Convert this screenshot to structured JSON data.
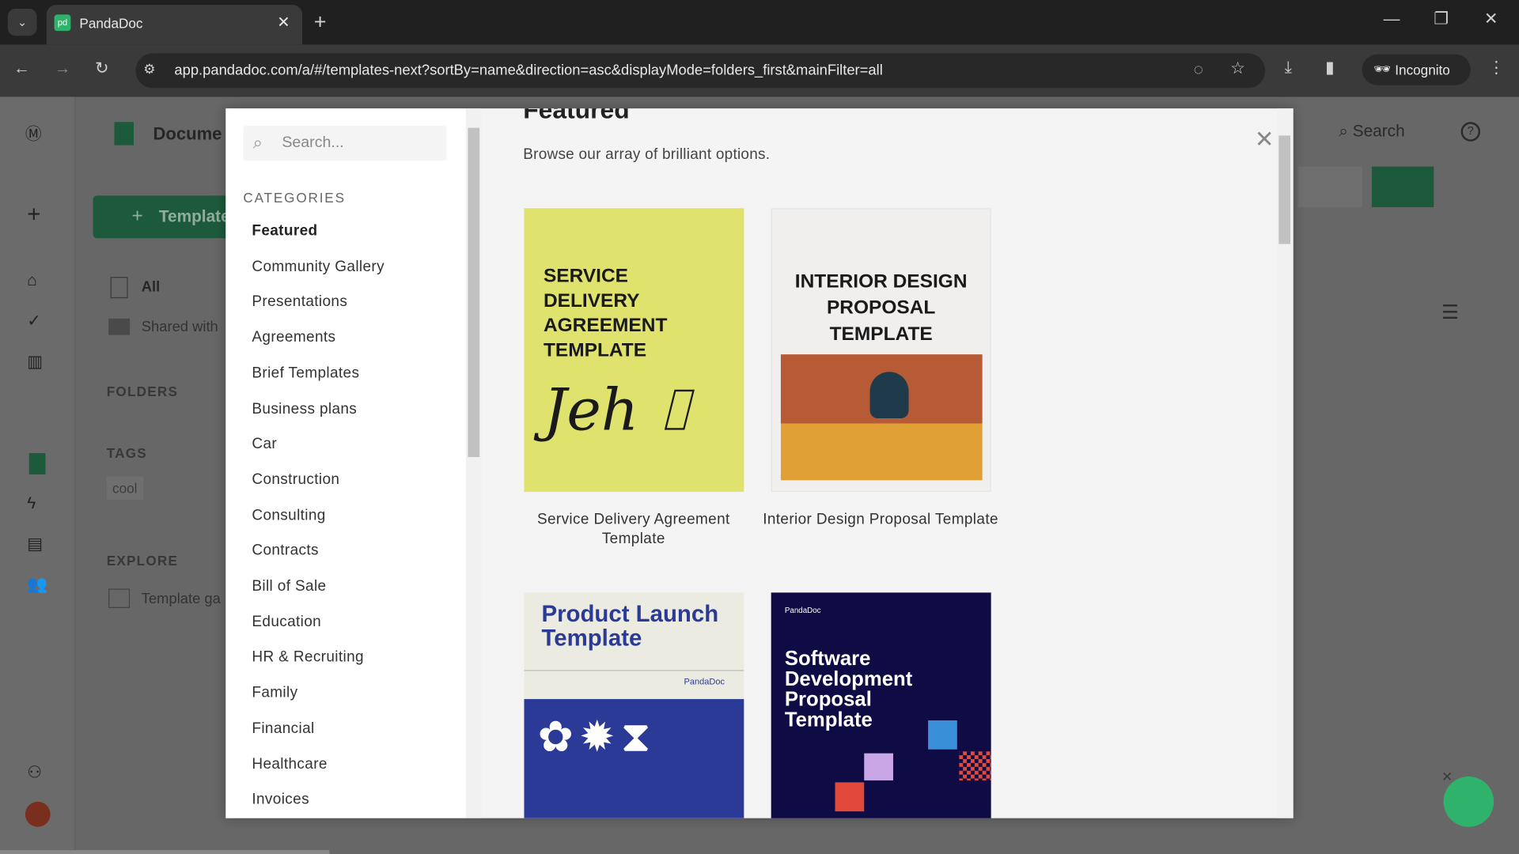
{
  "browser": {
    "tab_title": "PandaDoc",
    "url": "app.pandadoc.com/a/#/templates-next?sortBy=name&direction=asc&displayMode=folders_first&mainFilter=all",
    "incognito_label": "Incognito"
  },
  "app": {
    "page_title": "Docume",
    "new_template_button": "Template",
    "nav": {
      "all": "All",
      "shared": "Shared with"
    },
    "folders_heading": "FOLDERS",
    "tags_heading": "TAGS",
    "tag": "cool",
    "explore_heading": "EXPLORE",
    "explore_item": "Template ga",
    "search_label": "Search"
  },
  "modal": {
    "search_placeholder": "Search...",
    "categories_heading": "CATEGORIES",
    "categories": [
      "Featured",
      "Community Gallery",
      "Presentations",
      "Agreements",
      "Brief Templates",
      "Business plans",
      "Car",
      "Construction",
      "Consulting",
      "Contracts",
      "Bill of Sale",
      "Education",
      "HR & Recruiting",
      "Family",
      "Financial",
      "Healthcare",
      "Invoices"
    ],
    "selected_category": "Featured",
    "heading": "Featured",
    "subtitle": "Browse our array of brilliant options.",
    "templates": [
      {
        "title": "Service Delivery Agreement Template",
        "cover_lines": [
          "SERVICE",
          "DELIVERY",
          "AGREEMENT",
          "TEMPLATE"
        ]
      },
      {
        "title": "Interior Design Proposal Template",
        "cover_lines": [
          "INTERIOR DESIGN",
          "PROPOSAL",
          "TEMPLATE"
        ]
      },
      {
        "title": "",
        "cover_lines": [
          "Product Launch",
          "Template"
        ],
        "brand": "PandaDoc"
      },
      {
        "title": "",
        "cover_lines": [
          "Software",
          "Development",
          "Proposal",
          "Template"
        ],
        "brand": "PandaDoc"
      }
    ]
  },
  "colors": {
    "brand_green": "#248a56",
    "card1_bg": "#dfe36e",
    "card4_bg": "#0e0b45",
    "card3_blue": "#2b3a96"
  }
}
